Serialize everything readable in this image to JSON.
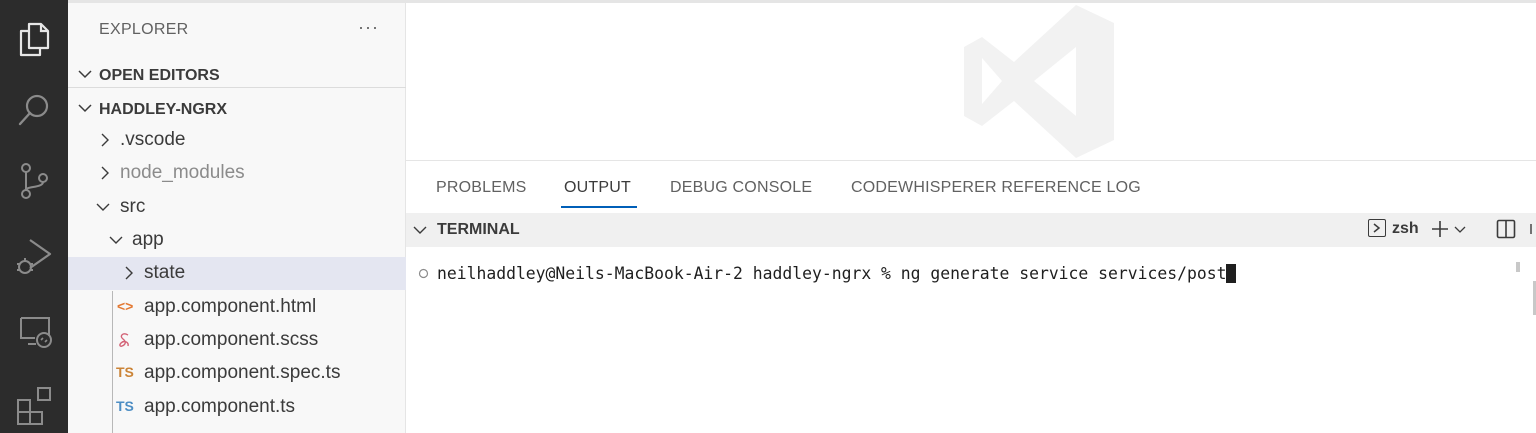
{
  "activity_bar": {
    "icons": [
      "explorer-icon",
      "search-icon",
      "source-control-icon",
      "run-debug-icon",
      "remote-explorer-icon",
      "extensions-icon"
    ]
  },
  "sidebar": {
    "title": "EXPLORER",
    "more": "···",
    "open_editors": "OPEN EDITORS",
    "project": "HADDLEY-NGRX",
    "tree": {
      "vscode": ".vscode",
      "node_modules": "node_modules",
      "src": "src",
      "app": "app",
      "state": "state",
      "html_file": "app.component.html",
      "scss_file": "app.component.scss",
      "spec_file": "app.component.spec.ts",
      "ts_file": "app.component.ts"
    },
    "file_badges": {
      "html": "<>",
      "ts": "TS"
    }
  },
  "panel": {
    "tabs": [
      "PROBLEMS",
      "OUTPUT",
      "DEBUG CONSOLE",
      "CODEWHISPERER REFERENCE LOG"
    ],
    "active_tab": "OUTPUT",
    "terminal_title": "TERMINAL",
    "shell": "zsh",
    "command_line": "neilhaddley@Neils-MacBook-Air-2 haddley-ngrx % ng generate service services/post"
  },
  "colors": {
    "activity_bar": "#2c2c2c",
    "sidebar_bg": "#f8f8f8",
    "selected_row": "#e4e6f1",
    "accent": "#005fb8",
    "html_icon": "#e37933",
    "scss_icon": "#d36276",
    "spec_ts_icon": "#cb8437",
    "ts_icon": "#4d8ec4"
  }
}
